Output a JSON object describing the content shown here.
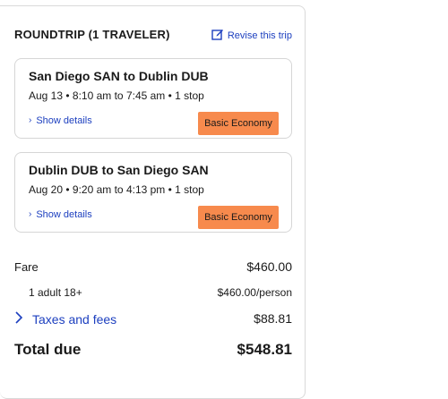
{
  "trip": {
    "title": "ROUNDTRIP (1 TRAVELER)",
    "revise_label": "Revise this trip",
    "legs": [
      {
        "route": "San Diego SAN to Dublin DUB",
        "times": "Aug 13 • 8:10 am to 7:45 am • 1 stop",
        "details_label": "Show details",
        "fare_class": "Basic Economy"
      },
      {
        "route": "Dublin DUB to San Diego SAN",
        "times": "Aug 20 • 9:20 am to 4:13 pm • 1 stop",
        "details_label": "Show details",
        "fare_class": "Basic Economy"
      }
    ]
  },
  "pricing": {
    "fare_label": "Fare",
    "fare_value": "$460.00",
    "adult_label": "1 adult 18+",
    "adult_value": "$460.00/person",
    "taxes_label": "Taxes and fees",
    "taxes_value": "$88.81",
    "total_label": "Total due",
    "total_value": "$548.81"
  },
  "colors": {
    "link": "#1c3fbf",
    "badge": "#f78a4d",
    "border": "#d6d6d6"
  },
  "icons": {
    "revise": "edit-icon",
    "details": "chevron-right-icon",
    "taxes": "chevron-right-icon"
  }
}
